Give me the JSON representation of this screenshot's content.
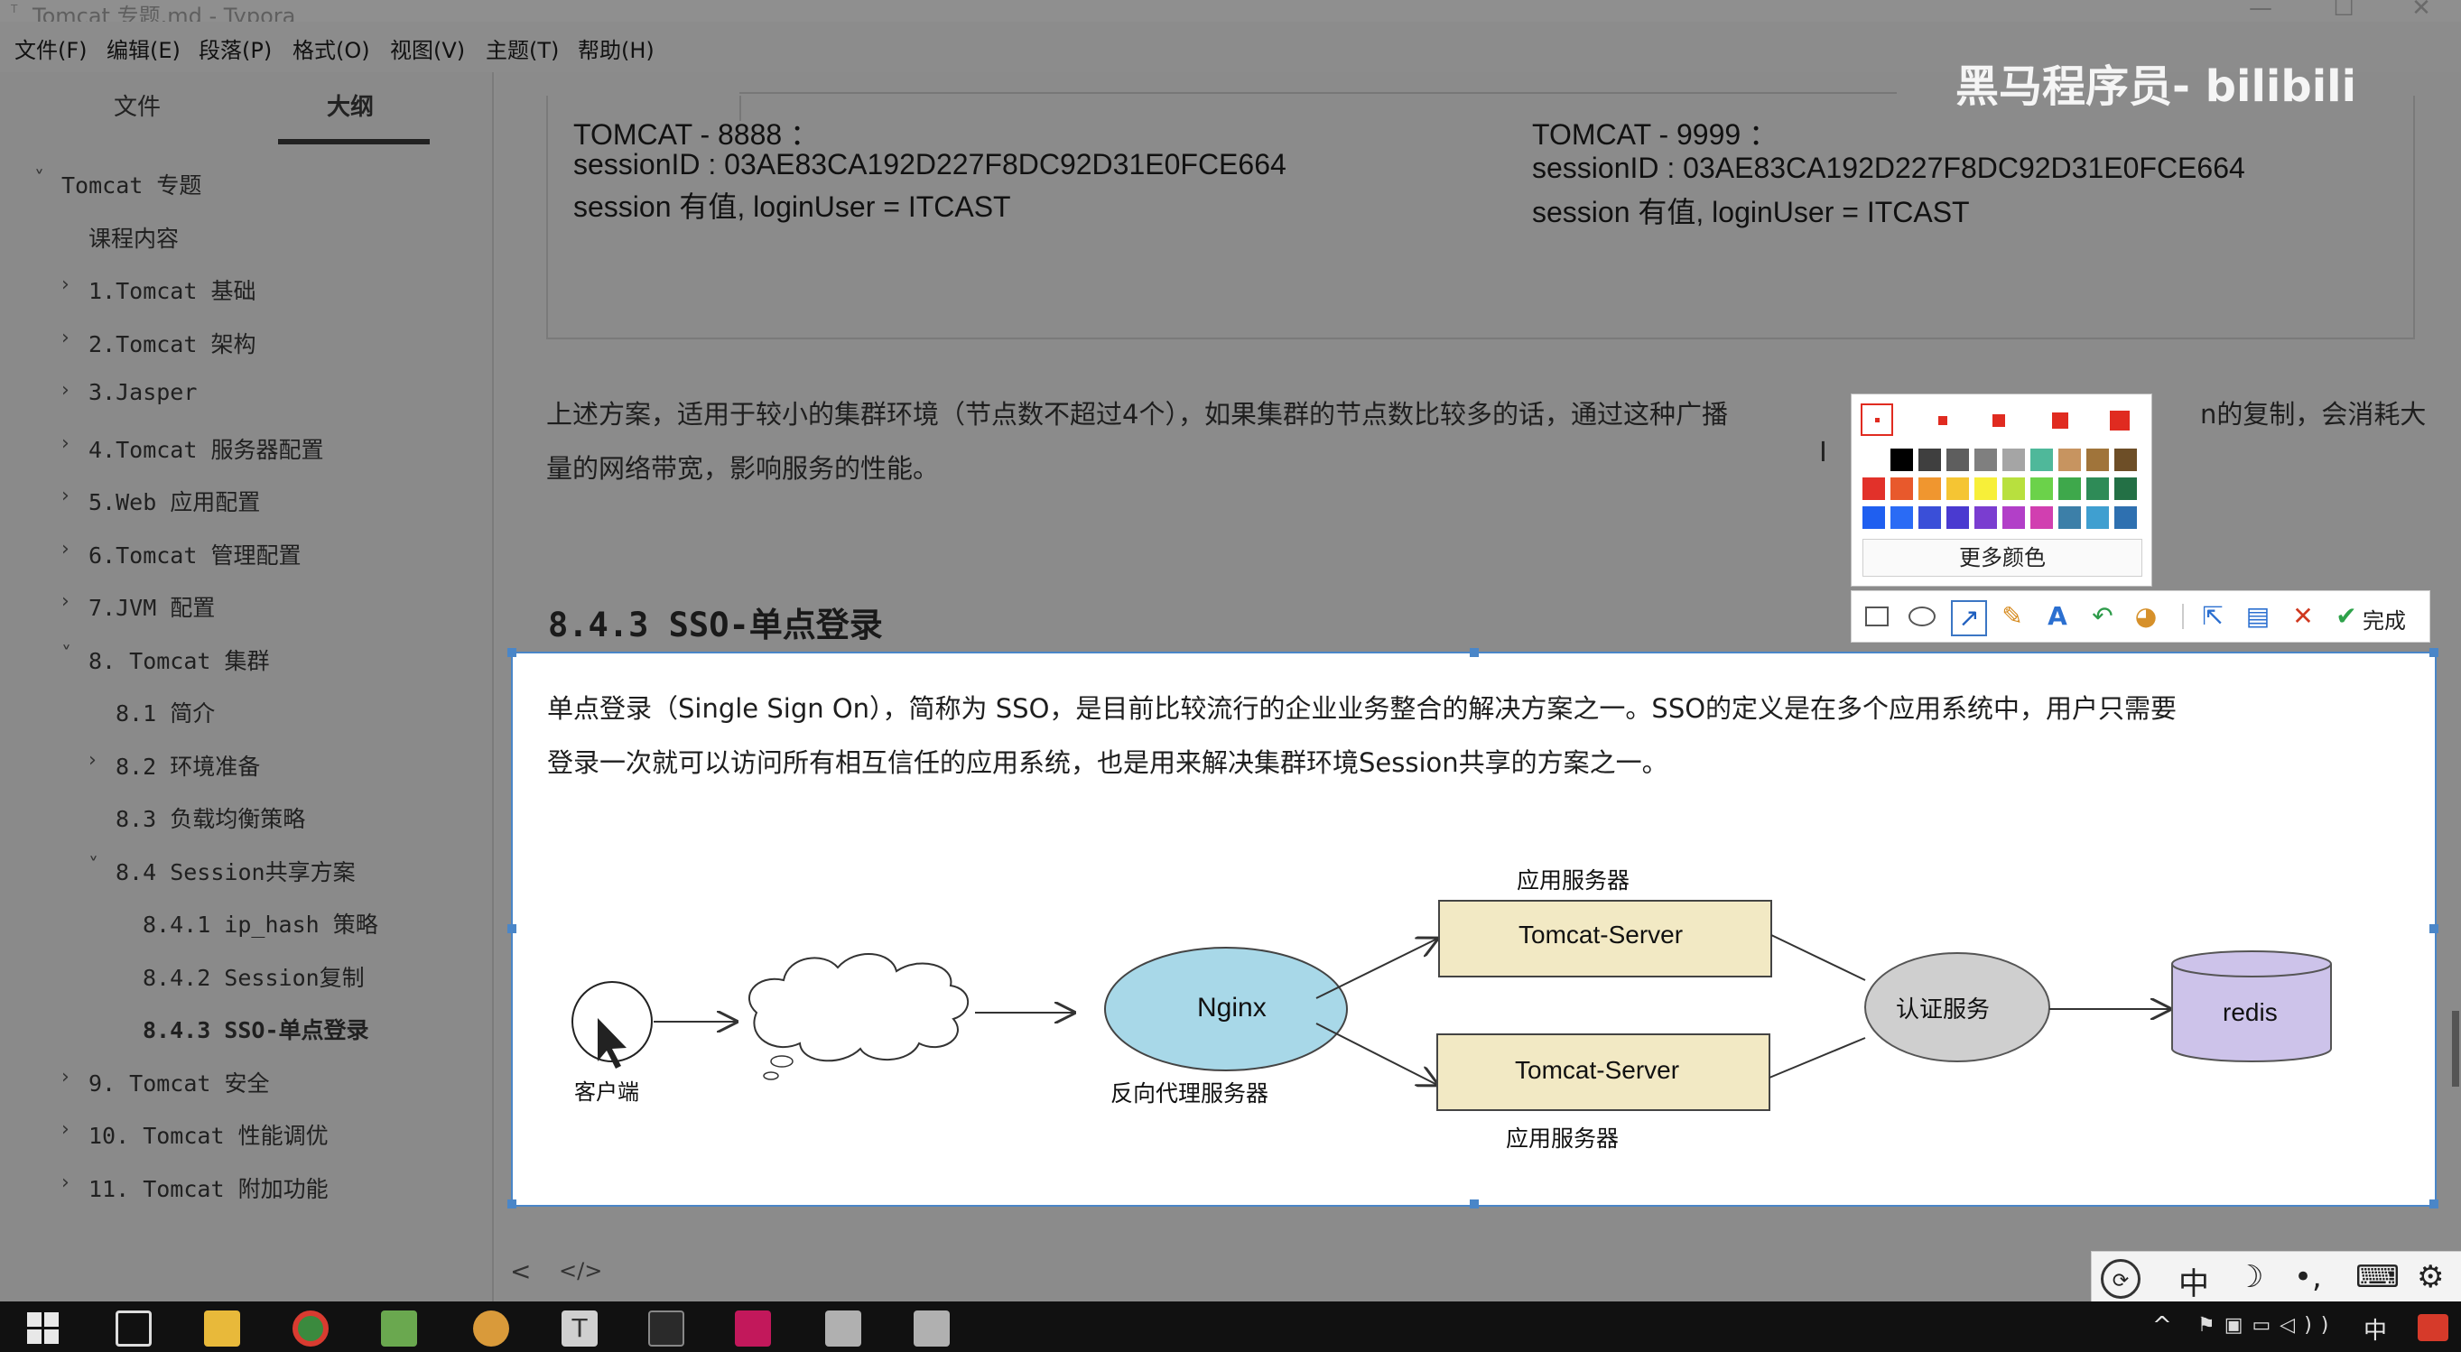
{
  "window": {
    "title": "Tomcat 专题.md - Typora",
    "minimize": "—",
    "maximize": "☐",
    "close": "✕"
  },
  "menu": [
    "文件(F)",
    "编辑(E)",
    "段落(P)",
    "格式(O)",
    "视图(V)",
    "主题(T)",
    "帮助(H)"
  ],
  "sidebar": {
    "tabs": [
      "文件",
      "大纲"
    ],
    "active_tab": "大纲",
    "outline": [
      {
        "label": "Tomcat 专题",
        "level": 0,
        "chevron": "˅"
      },
      {
        "label": "课程内容",
        "level": 1,
        "chevron": ""
      },
      {
        "label": "1.Tomcat 基础",
        "level": 1,
        "chevron": "›"
      },
      {
        "label": "2.Tomcat 架构",
        "level": 1,
        "chevron": "›"
      },
      {
        "label": "3.Jasper",
        "level": 1,
        "chevron": "›"
      },
      {
        "label": "4.Tomcat 服务器配置",
        "level": 1,
        "chevron": "›"
      },
      {
        "label": "5.Web 应用配置",
        "level": 1,
        "chevron": "›"
      },
      {
        "label": "6.Tomcat 管理配置",
        "level": 1,
        "chevron": "›"
      },
      {
        "label": "7.JVM 配置",
        "level": 1,
        "chevron": "›"
      },
      {
        "label": "8. Tomcat 集群",
        "level": 1,
        "chevron": "˅"
      },
      {
        "label": "8.1 简介",
        "level": 2,
        "chevron": ""
      },
      {
        "label": "8.2 环境准备",
        "level": 2,
        "chevron": "›"
      },
      {
        "label": "8.3 负载均衡策略",
        "level": 2,
        "chevron": ""
      },
      {
        "label": "8.4 Session共享方案",
        "level": 2,
        "chevron": "˅"
      },
      {
        "label": "8.4.1 ip_hash 策略",
        "level": 3,
        "chevron": ""
      },
      {
        "label": "8.4.2 Session复制",
        "level": 3,
        "chevron": ""
      },
      {
        "label": "8.4.3 SSO-单点登录",
        "level": 3,
        "chevron": "",
        "active": true
      },
      {
        "label": "9. Tomcat 安全",
        "level": 1,
        "chevron": "›"
      },
      {
        "label": "10. Tomcat 性能调优",
        "level": 1,
        "chevron": "›"
      },
      {
        "label": "11. Tomcat 附加功能",
        "level": 1,
        "chevron": "›"
      }
    ]
  },
  "editor": {
    "box_left": [
      "TOMCAT - 8888 ：",
      "sessionID : 03AE83CA192D227F8DC92D31E0FCE664",
      "session 有值, loginUser = ITCAST"
    ],
    "box_right": [
      "TOMCAT - 9999 ：",
      "sessionID : 03AE83CA192D227F8DC92D31E0FCE664",
      "session 有值, loginUser = ITCAST"
    ],
    "para1_line1a": "上述方案，适用于较小的集群环境（节点数不超过4个），如果集群的节点数比较多的话，通过这种广播",
    "para1_line1b": "n的复制，会消耗大",
    "para1_line2": "量的网络带宽，影响服务的性能。",
    "heading": "8.4.3 SSO-单点登录",
    "para2_line1": "单点登录（Single Sign On），简称为 SSO，是目前比较流行的企业业务整合的解决方案之一。SSO的定义是在多个应用系统中，用户只需要",
    "para2_line2": "登录一次就可以访问所有相互信任的应用系统，也是用来解决集群环境Session共享的方案之一。",
    "footer_left": "<",
    "footer_code": "</>"
  },
  "diagram": {
    "client_label": "客户端",
    "nginx_label": "Nginx",
    "nginx_caption": "反向代理服务器",
    "server_top": "Tomcat-Server",
    "server_bottom": "Tomcat-Server",
    "server_caption_top": "应用服务器",
    "server_caption_bottom": "应用服务器",
    "auth_label": "认证服务",
    "redis_label": "redis",
    "colors": {
      "nginx": "#a8d8e8",
      "server": "#f2e9c4",
      "auth": "#cfcfcf",
      "redis": "#cdc3ea"
    }
  },
  "picker": {
    "more_colors": "更多颜色",
    "palette": [
      [
        "#ffffff",
        "#000000",
        "#3f3f3f",
        "#5e5e5e",
        "#7f7f7f",
        "#a5a5a5",
        "#4fb89a",
        "#c79460",
        "#a0743a",
        "#6d4e27"
      ],
      [
        "#e2312a",
        "#e8592c",
        "#f0962f",
        "#f5c533",
        "#f7ef39",
        "#b8e03e",
        "#6bd24a",
        "#3ea84b",
        "#2e8b57",
        "#237045"
      ],
      [
        "#1f5ff0",
        "#2a6bf5",
        "#3a4fd8",
        "#4a3ad0",
        "#7a3dd0",
        "#b23fc8",
        "#d13fb0",
        "#3c7fa8",
        "#3f9fd0",
        "#2e70b0"
      ]
    ],
    "tools": [
      "rect-tool",
      "ellipse-tool",
      "arrow-tool",
      "pen-tool",
      "text-tool",
      "undo-tool",
      "mosaic-tool"
    ],
    "actions": [
      "share",
      "save",
      "cancel",
      "done"
    ],
    "done_label": "完成"
  },
  "ime": [
    "中",
    "☽",
    "•,",
    "⌨",
    "⚙"
  ],
  "tray": [
    "^",
    "中"
  ],
  "watermark": "黑马程序员- bilibili"
}
